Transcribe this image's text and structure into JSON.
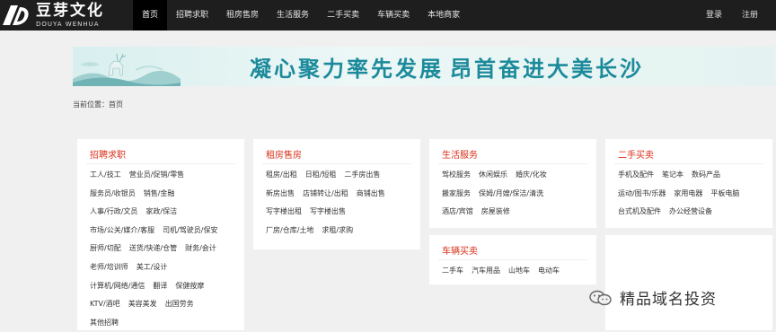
{
  "brand": {
    "name_cn": "豆芽文化",
    "name_en": "DOUYA WENHUA"
  },
  "nav": [
    "首页",
    "招聘求职",
    "租房售房",
    "生活服务",
    "二手买卖",
    "车辆买卖",
    "本地商家"
  ],
  "auth": {
    "login": "登录",
    "register": "注册"
  },
  "banner": {
    "text1": "凝心聚力率先发展",
    "text2": "昂首奋进大美长沙"
  },
  "breadcrumb": "当前位置：首页",
  "categories": [
    {
      "title": "招聘求职",
      "rows": [
        [
          "工人/技工",
          "营业员/促销/零售"
        ],
        [
          "服务员/收银员",
          "销售/金融"
        ],
        [
          "人事/行政/文员",
          "家政/保洁"
        ],
        [
          "市场/公关/媒介/客服",
          "司机/驾驶员/保安"
        ],
        [
          "厨师/切配",
          "送货/快递/仓管",
          "财务/会计"
        ],
        [
          "老师/培训师",
          "美工/设计"
        ],
        [
          "计算机/网络/通信",
          "翻译",
          "保健按摩"
        ],
        [
          "KTV/酒吧",
          "美容美发",
          "出国劳务"
        ],
        [
          "其他招聘"
        ]
      ]
    },
    {
      "title": "租房售房",
      "rows": [
        [
          "租房/出租",
          "日租/短租",
          "二手房出售"
        ],
        [
          "新房出售",
          "店铺转让/出租",
          "商铺出售"
        ],
        [
          "写字楼出租",
          "写字楼出售"
        ],
        [
          "厂房/仓库/土地",
          "求租/求购"
        ]
      ]
    },
    {
      "title": "生活服务",
      "rows": [
        [
          "驾校服务",
          "休闲娱乐",
          "婚庆/化妆"
        ],
        [
          "搬家服务",
          "保姆/月嫂/保洁/清洗"
        ],
        [
          "酒店/宾馆",
          "房屋装修"
        ]
      ]
    },
    {
      "title": "车辆买卖",
      "rows": [
        [
          "二手车",
          "汽车用品",
          "山地车",
          "电动车"
        ]
      ]
    },
    {
      "title": "二手买卖",
      "rows": [
        [
          "手机及配件",
          "笔记本",
          "数码产品"
        ],
        [
          "运动/图书/乐器",
          "家用电器",
          "平板电脑"
        ],
        [
          "台式机及配件",
          "办公经营设备"
        ]
      ]
    }
  ],
  "watermark": "精品域名投资",
  "colors": {
    "topbar": "#1e1e1e",
    "accent": "#d9301a",
    "banner_text": "#1b8a9b"
  }
}
